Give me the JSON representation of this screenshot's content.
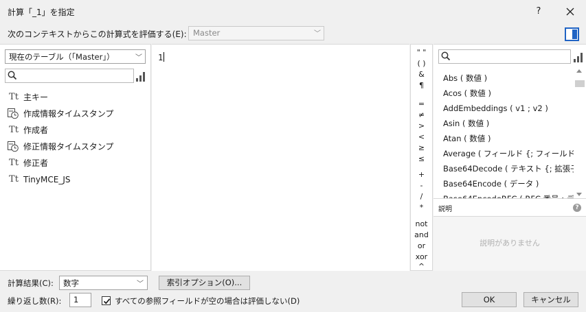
{
  "window": {
    "title": "計算「_1」を指定",
    "help_label": "?"
  },
  "context": {
    "label": "次のコンテキストからこの計算式を評価する(E):",
    "selected": "Master"
  },
  "left_panel": {
    "table_select": "現在のテーブル（「Master」）",
    "search_placeholder": "",
    "fields": [
      {
        "icon": "text-field-icon",
        "name": "主キー"
      },
      {
        "icon": "timestamp-field-icon",
        "name": "作成情報タイムスタンプ"
      },
      {
        "icon": "text-field-icon",
        "name": "作成者"
      },
      {
        "icon": "timestamp-field-icon",
        "name": "修正情報タイムスタンプ"
      },
      {
        "icon": "text-field-icon",
        "name": "修正者"
      },
      {
        "icon": "text-field-icon",
        "name": "TinyMCE_JS"
      }
    ]
  },
  "editor": {
    "content": "1"
  },
  "operators": [
    "\" \"",
    "( )",
    "&",
    "¶",
    "=",
    "≠",
    ">",
    "<",
    "≥",
    "≤",
    "+",
    "-",
    "/",
    "*",
    "not",
    "and",
    "or",
    "xor",
    "^"
  ],
  "functions": {
    "search_placeholder": "",
    "items": [
      "Abs ( 数値 )",
      "Acos ( 数値 )",
      "AddEmbeddings ( v1 ; v2 )",
      "Asin ( 数値 )",
      "Atan ( 数値 )",
      "Average ( フィールド {; フィールド...} )",
      "Base64Decode ( テキスト {; 拡張子...",
      "Base64Encode ( データ )",
      "Base64EncodeRFC ( RFC 番号 ; デ..."
    ]
  },
  "description": {
    "header": "説明",
    "empty_text": "説明がありません"
  },
  "bottom": {
    "result_label": "計算結果(C):",
    "result_value": "数字",
    "index_button": "索引オプション(O)...",
    "repeat_label": "繰り返し数(R):",
    "repeat_value": "1",
    "checkbox_label": "すべての参照フィールドが空の場合は評価しない(D)",
    "checkbox_checked": true,
    "ok_label": "OK",
    "cancel_label": "キャンセル"
  },
  "colors": {
    "accent": "#1f63c4",
    "panel_bg": "#ffffff",
    "dialog_bg": "#f0f0f0"
  }
}
